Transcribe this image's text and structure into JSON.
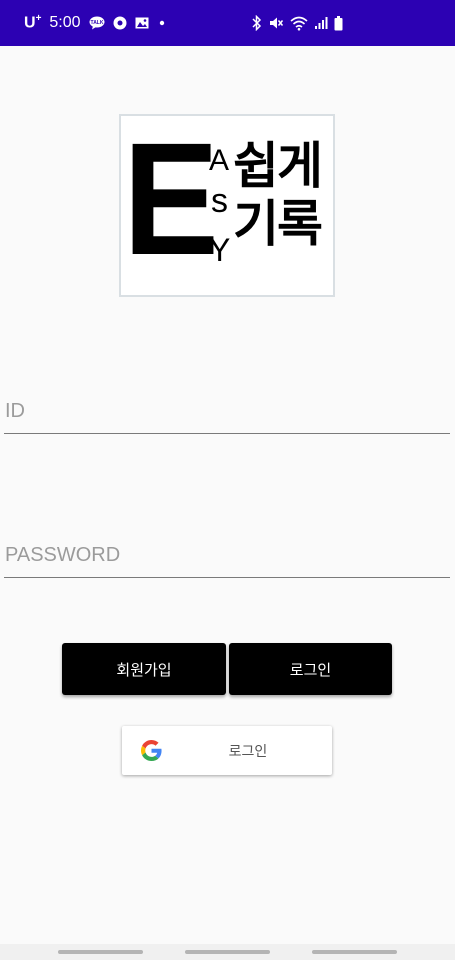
{
  "status_bar": {
    "carrier": "U",
    "carrier_sup": "+",
    "time": "5:00",
    "background": "#2c01b3"
  },
  "logo": {
    "big_letter": "E",
    "letter_a": "A",
    "letter_s": "s",
    "letter_y": "Y",
    "korean_line1": "쉽게",
    "korean_line2": "기록"
  },
  "form": {
    "id_placeholder": "ID",
    "id_value": "",
    "password_placeholder": "PASSWORD",
    "password_value": ""
  },
  "buttons": {
    "signup_label": "회원가입",
    "login_label": "로그인",
    "google_login_label": "로그인"
  },
  "icons": {
    "google": "google-g-icon",
    "talk": "talk-icon",
    "media": "media-icon",
    "image": "image-icon",
    "bluetooth": "bluetooth-icon",
    "mute": "mute-icon",
    "wifi": "wifi-icon",
    "signal": "signal-icon",
    "battery": "battery-icon"
  }
}
